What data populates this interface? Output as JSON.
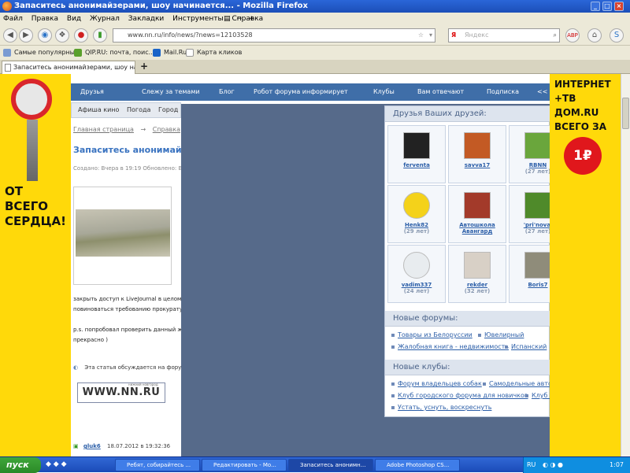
{
  "window": {
    "title": "Запаситесь анонимайзерами, шоу начинается... - Mozilla Firefox"
  },
  "menu": [
    "Файл",
    "Правка",
    "Вид",
    "Журнал",
    "Закладки",
    "Инструменты",
    "Справка"
  ],
  "navbar": {
    "url": "www.nn.ru/info/news/?news=12103528",
    "search_placeholder": "Яндекс"
  },
  "bookmarks": [
    "Самые популярные",
    "QIP.RU: почта, поис...",
    "Mail.Ru",
    "Карта кликов"
  ],
  "tab": {
    "title": "Запаситесь анонимайзерами, шоу начин...",
    "new_tab": "+"
  },
  "ads": {
    "left_text": "ОТ ВСЕГО СЕРДЦА!",
    "right_text": "ИНТЕРНЕТ +ТВ ДОМ.RU ВСЕГО ЗА",
    "right_price": "1₽"
  },
  "site_nav": {
    "items": [
      "Друзья",
      "Слежу за темами",
      "Блог",
      "Робот форума информирует",
      "Клубы",
      "Вам отвечают",
      "Подписка",
      "<<"
    ],
    "sub": [
      "Афиша кино",
      "Погода",
      "Город"
    ]
  },
  "breadcrumb": {
    "home": "Главная страница",
    "arrow": "→",
    "section": "Справка"
  },
  "article": {
    "title": "Запаситесь анонимайз",
    "meta": "Создано: Вчера в 19:19 Обновлено: В",
    "lines": [
      "закрыть доступ к LiveJournal в целом,",
      "повиноваться требованию прокуратур",
      "р.s. попробовал проверить данный жи",
      "прекрасно )"
    ],
    "discuss": "Эта статья обсуждается на форум",
    "logo": "WWW.NN.RU",
    "logo_sub": "нижний новгород",
    "comment_user": "gluk6",
    "comment_date": "18.07.2012 в 19:32:36"
  },
  "panel": {
    "friends_title": "Друзья Ваших друзей:",
    "friends": [
      {
        "name": "ferventa",
        "age": ""
      },
      {
        "name": "savva17",
        "age": ""
      },
      {
        "name": "RBNN",
        "age": "(27 лет)"
      },
      {
        "name": "Henk82",
        "age": "(29 лет)"
      },
      {
        "name": "Автошкола Авангард",
        "age": ""
      },
      {
        "name": "'pri'nova'",
        "age": "(27 лет)"
      },
      {
        "name": "vadim337",
        "age": "(24 лет)"
      },
      {
        "name": "rekder",
        "age": "(32 лет)"
      },
      {
        "name": "Boris7",
        "age": ""
      }
    ],
    "forums_title": "Новые форумы:",
    "forums": [
      "Товары из Белоруссии",
      "Ювелирный",
      "Жалобная книга - недвижимость",
      "Испанский"
    ],
    "clubs_title": "Новые клубы:",
    "clubs": [
      "Форум владельцев собак",
      "Самодельные авто",
      "Клуб городского форума для новичков",
      "Клуб Л",
      "Устать, уснуть, воскреснуть"
    ]
  },
  "taskbar": {
    "start": "пуск",
    "tasks": [
      "Ребят, собирайтесь ...",
      "Редактировать - Мо...",
      "Запаситесь анонимн...",
      "Adobe Photoshop CS..."
    ],
    "lang": "RU",
    "time": "1:07"
  }
}
